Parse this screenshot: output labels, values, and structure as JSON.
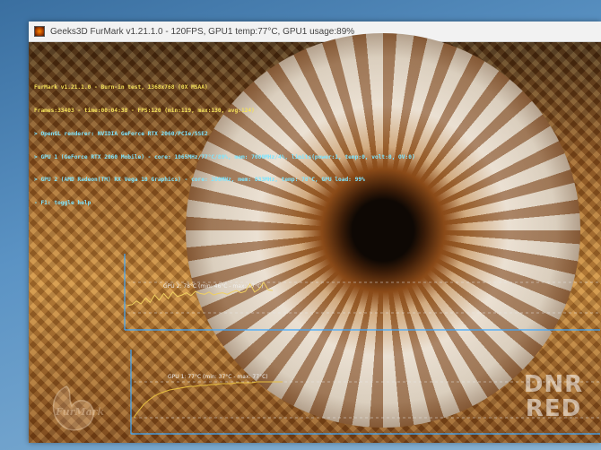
{
  "window": {
    "title": "Geeks3D FurMark v1.21.1.0 - 120FPS, GPU1 temp:77°C, GPU1 usage:89%"
  },
  "overlay": {
    "title": "FurMark v1.21.1.0 - Burn-in test, 1368x768 (0X MSAA)",
    "frames": "Frames:33403 - time:00:04:38 - FPS:120 (min:119, max:130, avg:124)",
    "lines": [
      "> OpenGL renderer: NVIDIA GeForce RTX 2060/PCIe/SSE2",
      "> GPU 1 (GeForce RTX 2060 Mobile) - core: 1065MHz/77°C/89%, mem: 7000MHz/4%, limits(power:1, temp:0, volt:0, OV:0)",
      "> GPU 2 (AMD Radeon(TM) RX Vega 10 Graphics) - core: 200MHz, mem: 833MHz, temp: 78°C, GPU load: 99%",
      "- F1: toggle help"
    ]
  },
  "graphs": {
    "gpu2": {
      "label": "GPU 2: 78°C (min: 46°C - max: 87°C)",
      "color": "#f0d060",
      "samples": [
        56,
        57,
        62,
        58,
        66,
        60,
        70,
        63,
        72,
        65,
        74,
        68,
        70,
        73,
        69,
        75,
        72,
        71,
        74,
        70,
        72,
        73,
        71,
        74,
        76,
        73,
        75,
        85,
        74,
        78,
        87,
        77,
        76
      ]
    },
    "gpu1": {
      "label": "GPU 1: 77°C (min: 37°C - max: 77°C)",
      "color": "#e8c040",
      "samples": [
        37,
        45,
        52,
        57,
        61,
        64,
        66,
        68,
        69,
        70,
        71,
        72,
        72,
        73,
        73,
        74,
        74,
        75,
        75,
        75,
        76,
        76,
        76,
        76,
        77,
        77,
        77,
        77,
        77,
        77
      ]
    }
  },
  "logo": {
    "text": "FurMark"
  },
  "watermark": {
    "line1": "DNR",
    "line2": "RED"
  }
}
